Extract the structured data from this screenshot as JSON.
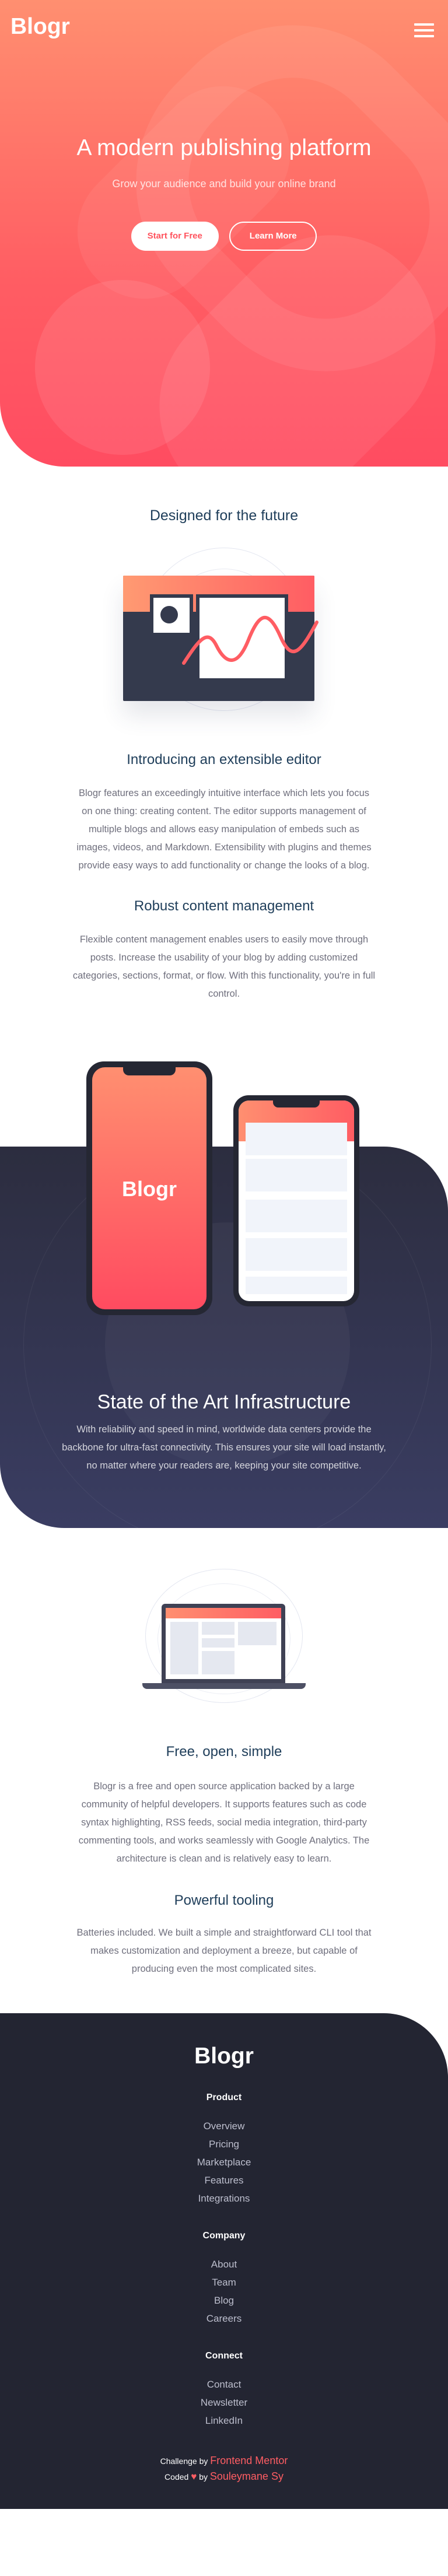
{
  "header": {
    "logo": "Blogr",
    "menu_icon": "hamburger-icon"
  },
  "hero": {
    "title": "A modern publishing platform",
    "subtitle": "Grow your audience and build your online brand",
    "primary_cta": "Start for Free",
    "secondary_cta": "Learn More"
  },
  "design": {
    "title": "Designed for the future",
    "sections": [
      {
        "heading": "Introducing an extensible editor",
        "body": "Blogr features an exceedingly intuitive interface which lets you focus on one thing: creating content. The editor supports management of multiple blogs and allows easy manipulation of embeds such as images, videos, and Markdown. Extensibility with plugins and themes provide easy ways to add functionality or change the looks of a blog."
      },
      {
        "heading": "Robust content management",
        "body": "Flexible content management enables users to easily move through posts. Increase the usability of your blog by adding customized categories, sections, format, or flow. With this functionality, you're in full control."
      }
    ]
  },
  "infrastructure": {
    "phone_logo": "Blogr",
    "title": "State of the Art Infrastructure",
    "body": "With reliability and speed in mind, worldwide data centers provide the backbone for ultra-fast connectivity. This ensures your site will load instantly, no matter where your readers are, keeping your site competitive."
  },
  "features": [
    {
      "heading": "Free, open, simple",
      "body": "Blogr is a free and open source application backed by a large community of helpful developers. It supports features such as code syntax highlighting, RSS feeds, social media integration, third-party commenting tools, and works seamlessly with Google Analytics. The architecture is clean and is relatively easy to learn."
    },
    {
      "heading": "Powerful tooling",
      "body": "Batteries included. We built a simple and straightforward CLI tool that makes customization and deployment a breeze, but capable of producing even the most complicated sites."
    }
  ],
  "footer": {
    "logo": "Blogr",
    "groups": [
      {
        "heading": "Product",
        "links": [
          "Overview",
          "Pricing",
          "Marketplace",
          "Features",
          "Integrations"
        ]
      },
      {
        "heading": "Company",
        "links": [
          "About",
          "Team",
          "Blog",
          "Careers"
        ]
      },
      {
        "heading": "Connect",
        "links": [
          "Contact",
          "Newsletter",
          "LinkedIn"
        ]
      }
    ],
    "attribution": {
      "challenge_prefix": "Challenge by",
      "challenge_link": "Frontend Mentor",
      "coded_prefix": "Coded",
      "heart_icon": "heart-icon",
      "coded_by": "by",
      "author": "Souleymane Sy"
    }
  },
  "colors": {
    "accent": "#ff5d63",
    "heading": "#1f3e5a",
    "dark": "#232532"
  }
}
